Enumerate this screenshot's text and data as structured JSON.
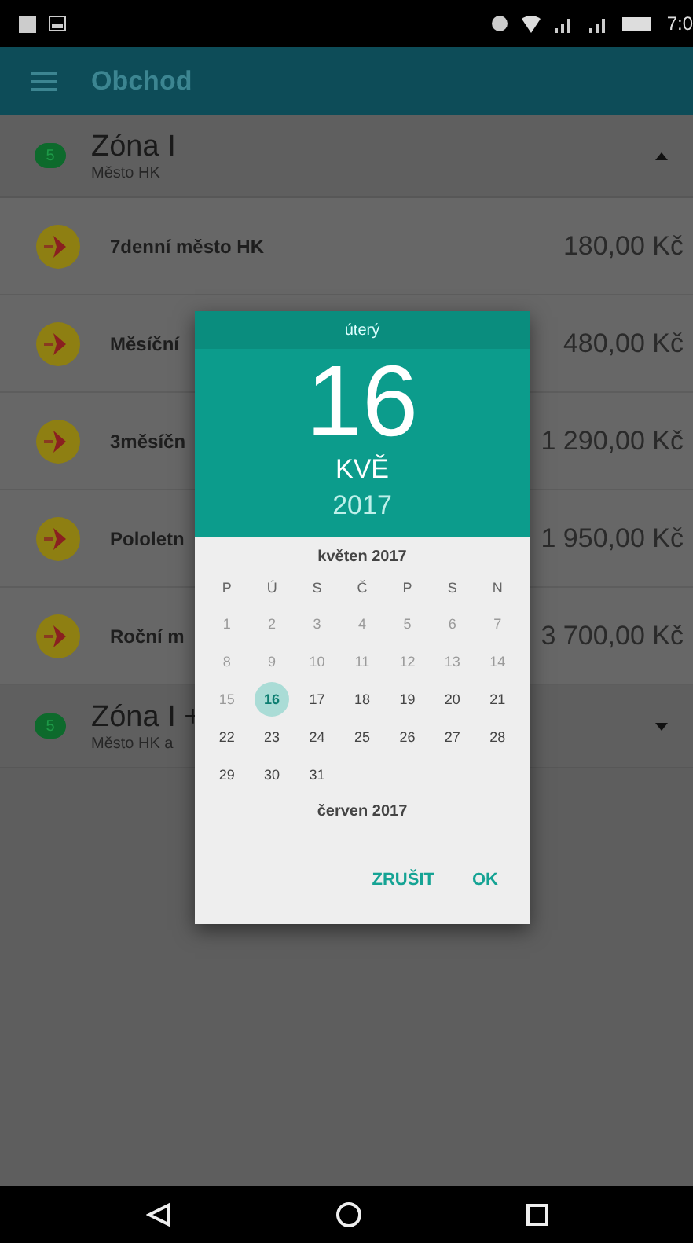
{
  "status_bar": {
    "time": "7:0"
  },
  "app_bar": {
    "title": "Obchod"
  },
  "zones": [
    {
      "badge": "5",
      "title": "Zóna I",
      "subtitle": "Město HK",
      "expanded": true,
      "items": [
        {
          "name": "7denní město HK",
          "price": "180,00 Kč"
        },
        {
          "name": "Měsíční",
          "price": "480,00 Kč"
        },
        {
          "name": "3měsíčn",
          "price": "1 290,00 Kč"
        },
        {
          "name": "Pololetn",
          "price": "1 950,00 Kč"
        },
        {
          "name": "Roční m",
          "price": "3 700,00 Kč"
        }
      ]
    },
    {
      "badge": "5",
      "title": "Zóna I +",
      "subtitle": "Město HK a",
      "expanded": false
    }
  ],
  "date_picker": {
    "weekday": "úterý",
    "day": "16",
    "month": "KVĚ",
    "year": "2017",
    "month_title": "květen 2017",
    "weekday_labels": [
      "P",
      "Ú",
      "S",
      "Č",
      "P",
      "S",
      "N"
    ],
    "days": [
      {
        "label": "1",
        "disabled": true,
        "selected": false
      },
      {
        "label": "2",
        "disabled": true,
        "selected": false
      },
      {
        "label": "3",
        "disabled": true,
        "selected": false
      },
      {
        "label": "4",
        "disabled": true,
        "selected": false
      },
      {
        "label": "5",
        "disabled": true,
        "selected": false
      },
      {
        "label": "6",
        "disabled": true,
        "selected": false
      },
      {
        "label": "7",
        "disabled": true,
        "selected": false
      },
      {
        "label": "8",
        "disabled": true,
        "selected": false
      },
      {
        "label": "9",
        "disabled": true,
        "selected": false
      },
      {
        "label": "10",
        "disabled": true,
        "selected": false
      },
      {
        "label": "11",
        "disabled": true,
        "selected": false
      },
      {
        "label": "12",
        "disabled": true,
        "selected": false
      },
      {
        "label": "13",
        "disabled": true,
        "selected": false
      },
      {
        "label": "14",
        "disabled": true,
        "selected": false
      },
      {
        "label": "15",
        "disabled": true,
        "selected": false
      },
      {
        "label": "16",
        "disabled": false,
        "selected": true
      },
      {
        "label": "17",
        "disabled": false,
        "selected": false
      },
      {
        "label": "18",
        "disabled": false,
        "selected": false
      },
      {
        "label": "19",
        "disabled": false,
        "selected": false
      },
      {
        "label": "20",
        "disabled": false,
        "selected": false
      },
      {
        "label": "21",
        "disabled": false,
        "selected": false
      },
      {
        "label": "22",
        "disabled": false,
        "selected": false
      },
      {
        "label": "23",
        "disabled": false,
        "selected": false
      },
      {
        "label": "24",
        "disabled": false,
        "selected": false
      },
      {
        "label": "25",
        "disabled": false,
        "selected": false
      },
      {
        "label": "26",
        "disabled": false,
        "selected": false
      },
      {
        "label": "27",
        "disabled": false,
        "selected": false
      },
      {
        "label": "28",
        "disabled": false,
        "selected": false
      },
      {
        "label": "29",
        "disabled": false,
        "selected": false
      },
      {
        "label": "30",
        "disabled": false,
        "selected": false
      },
      {
        "label": "31",
        "disabled": false,
        "selected": false
      }
    ],
    "next_month_title": "červen 2017",
    "buttons": [
      "ZRUŠIT",
      "OK"
    ]
  }
}
